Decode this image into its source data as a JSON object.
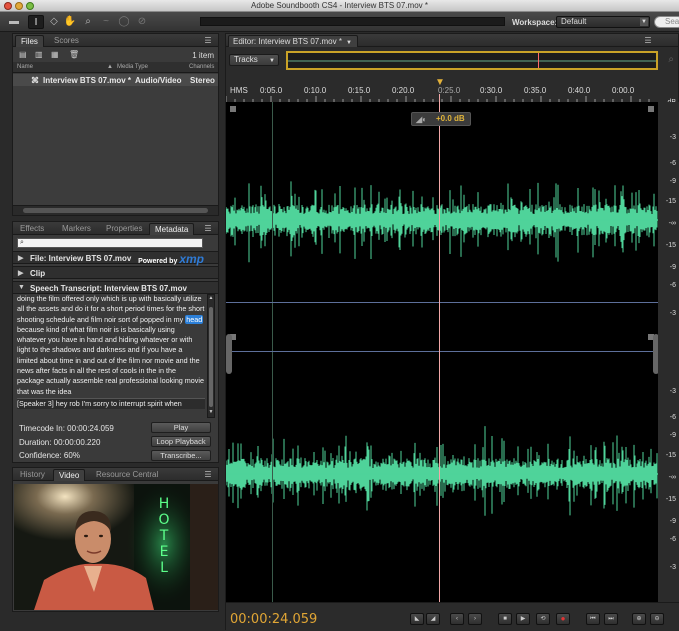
{
  "window": {
    "title": "Adobe Soundbooth CS4 - Interview BTS 07.mov *"
  },
  "toolbar": {
    "workspace_label": "Workspace:",
    "workspace_value": "Default",
    "search_placeholder": "Sea"
  },
  "files_panel": {
    "tabs": [
      "Files",
      "Scores"
    ],
    "count": "1 item",
    "columns": [
      "Name",
      "Media Type",
      "Channels"
    ],
    "rows": [
      {
        "name": "Interview BTS 07.mov *",
        "media_type": "Audio/Video",
        "channels": "Stereo"
      }
    ]
  },
  "meta_panel": {
    "tabs": [
      "Effects",
      "Markers",
      "Properties",
      "Metadata"
    ],
    "file_section": "File:  Interview BTS 07.mov",
    "powered_by": "Powered by",
    "xmp": "xmp",
    "clip_section": "Clip",
    "transcript_section": "Speech Transcript:  Interview BTS 07.mov",
    "transcript_before": "doing the film offered only which is up with basically utilize all the assets and do it for a short period times for the short shooting schedule and film noir sort of popped in my ",
    "transcript_highlight": "head",
    "transcript_after": " because kind of what film noir is is basically using whatever you have in hand and hiding whatever or with light to the shadows and darkness and if you have a limited about time in and out of the film nor movie and the news after facts in all the rest of cools in the in the package actually assemble real professional looking movie that was the idea",
    "transcript_speaker": "[Speaker 3] hey rob I'm sorry to interrupt   spirit when",
    "timecode_in": "Timecode In: 00:00:24.059",
    "duration": "Duration: 00:00:00.220",
    "confidence": "Confidence: 60%",
    "play_label": "Play",
    "loop_label": "Loop Playback",
    "transcribe_label": "Transcribe..."
  },
  "video_panel": {
    "tabs": [
      "History",
      "Video",
      "Resource Central"
    ],
    "sign_text": "HOTEL"
  },
  "editor": {
    "tab_title": "Editor: Interview BTS 07.mov *",
    "tracks_label": "Tracks",
    "ruler_unit": "HMS",
    "ruler_labels": [
      "0:05.0",
      "0:10.0",
      "0:15.0",
      "0:20.0",
      "0:25.0",
      "0:30.0",
      "0:35.0",
      "0:40.0",
      "0:00.0"
    ],
    "hud_value": "+0.0 dB",
    "db_unit": "dB",
    "db_labels_ch1": [
      "-3",
      "-6",
      "-9",
      "-15",
      "-∞",
      "-15",
      "-9",
      "-6",
      "-3"
    ],
    "db_labels_ch2": [
      "-3",
      "-6",
      "-9",
      "-15",
      "-∞",
      "-15",
      "-9",
      "-6",
      "-3"
    ],
    "timecode": "00:00:24.059",
    "playhead_seconds": 24.059,
    "waveform_color": "#4fd39a",
    "playhead_color": "#e1a635",
    "transport_icons": [
      "go-to-start-icon",
      "go-to-end-icon",
      "rewind-icon",
      "fast-forward-icon",
      "stop-icon",
      "play-icon",
      "loop-icon",
      "record-icon",
      "previous-marker-icon",
      "next-marker-icon",
      "zoom-in-icon",
      "zoom-out-icon"
    ]
  }
}
